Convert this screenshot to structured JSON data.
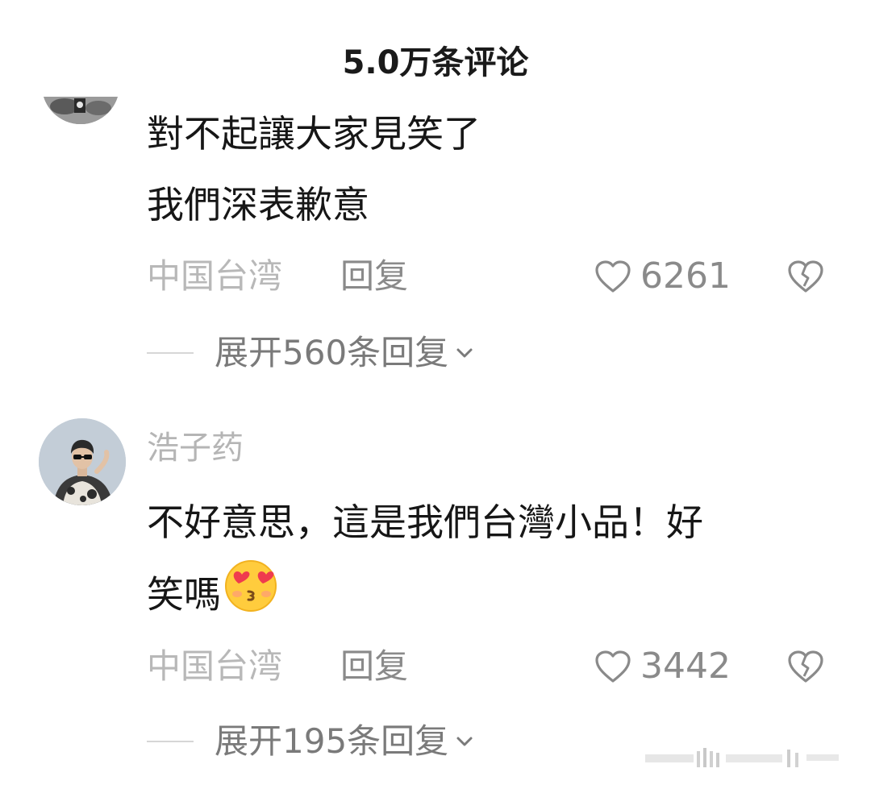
{
  "header": {
    "title": "5.0万条评论"
  },
  "comments": [
    {
      "text": "對不起讓大家見笑了\n我們深表歉意",
      "location": "中国台湾",
      "reply_label": "回复",
      "likes": "6261",
      "expand_label": "展开560条回复"
    },
    {
      "username": "浩子药",
      "text": "不好意思，這是我們台灣小品！好\n笑嗎",
      "emoji": "face-blowing-kiss-with-heart-eyes",
      "location": "中国台湾",
      "reply_label": "回复",
      "likes": "3442",
      "expand_label": "展开195条回复"
    }
  ],
  "icons": {
    "like": "heart-outline-icon",
    "dislike": "broken-heart-icon",
    "expand": "chevron-down-icon"
  },
  "colors": {
    "text_primary": "#161616",
    "text_secondary": "#b8b8b8",
    "text_meta": "#8a8a8a"
  }
}
